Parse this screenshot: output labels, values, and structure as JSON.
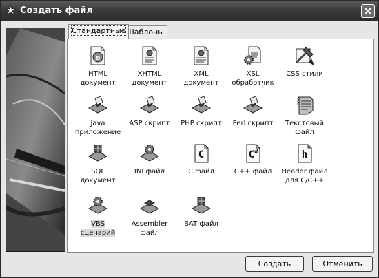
{
  "window": {
    "title": "Создать файл"
  },
  "tabs": [
    {
      "label": "Стандартные"
    },
    {
      "label": "Шаблоны"
    }
  ],
  "items": [
    {
      "label": "HTML\nдокумент",
      "icon": "html-document-icon"
    },
    {
      "label": "XHTML\nдокумент",
      "icon": "xhtml-document-icon"
    },
    {
      "label": "XML\nдокумент",
      "icon": "xml-document-icon"
    },
    {
      "label": "XSL\nобработчик",
      "icon": "xsl-processor-icon"
    },
    {
      "label": "CSS стили",
      "icon": "css-styles-icon"
    },
    {
      "label": "Java\nприложение",
      "icon": "java-app-icon"
    },
    {
      "label": "ASP скрипт",
      "icon": "asp-script-icon"
    },
    {
      "label": "PHP скрипт",
      "icon": "php-script-icon"
    },
    {
      "label": "Perl скрипт",
      "icon": "perl-script-icon"
    },
    {
      "label": "Текстовый\nфайл",
      "icon": "text-file-icon"
    },
    {
      "label": "SQL\nдокумент",
      "icon": "sql-document-icon"
    },
    {
      "label": "INI файл",
      "icon": "ini-file-icon"
    },
    {
      "label": "C файл",
      "icon": "c-file-icon"
    },
    {
      "label": "C++ файл",
      "icon": "cpp-file-icon"
    },
    {
      "label": "Header файл\nдля C/C++",
      "icon": "header-file-icon"
    },
    {
      "label": "VBS\nсценарий",
      "icon": "vbs-script-icon"
    },
    {
      "label": "Assembler\nфайл",
      "icon": "assembler-file-icon"
    },
    {
      "label": "BAT файл",
      "icon": "bat-file-icon"
    }
  ],
  "buttons": {
    "create": "Создать",
    "cancel": "Отменить"
  }
}
